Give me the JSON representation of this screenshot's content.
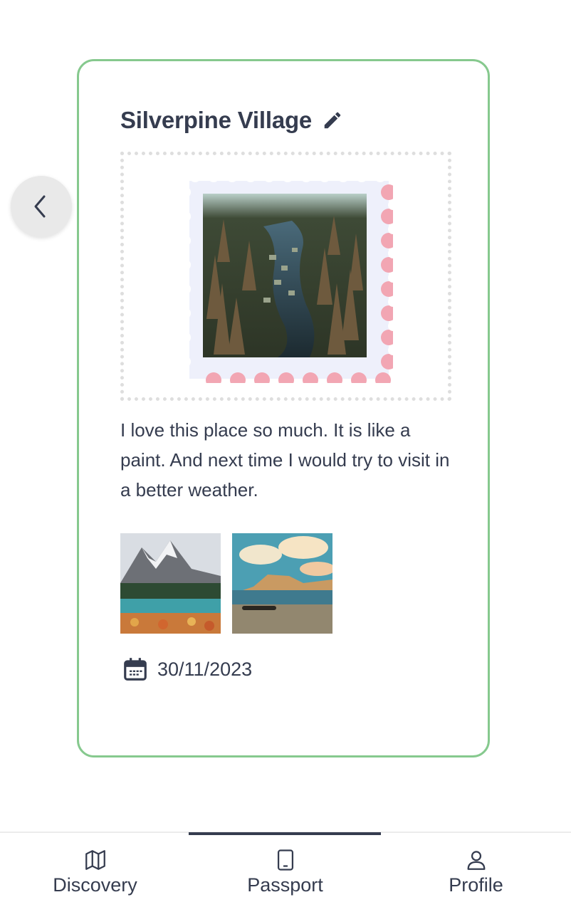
{
  "card": {
    "title": "Silverpine Village",
    "note": "I love this place so much. It is like a paint. And next time I would try to visit in a better weather.",
    "date": "30/11/2023",
    "stamp": {
      "image": "forest-village-aerial-photo",
      "perforation_colors": [
        "#eef0fb",
        "#f2a6b3"
      ]
    },
    "photos": [
      {
        "image": "snowy-mountain-lake-photo"
      },
      {
        "image": "lake-boat-sunset-photo"
      }
    ]
  },
  "icons": {
    "edit": "pencil-icon",
    "prev": "chevron-left-icon",
    "date": "calendar-icon"
  },
  "nav": {
    "items": [
      {
        "label": "Discovery",
        "icon": "map-icon",
        "active": false
      },
      {
        "label": "Passport",
        "icon": "tablet-icon",
        "active": true
      },
      {
        "label": "Profile",
        "icon": "user-icon",
        "active": false
      }
    ]
  },
  "colors": {
    "card_border": "#86c98e",
    "text": "#353c4f",
    "active_indicator": "#353c4f",
    "stamp_pink": "#f2a6b3"
  }
}
